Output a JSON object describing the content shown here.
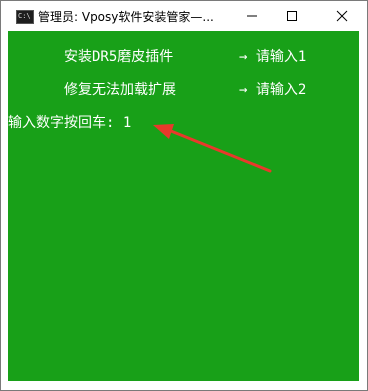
{
  "window": {
    "title": "管理员:  Vposy软件安装管家—...",
    "app_icon": "cmd-icon",
    "app_icon_text": "C:\\"
  },
  "controls": {
    "minimize": "minimize-icon",
    "maximize": "maximize-icon",
    "close": "close-icon"
  },
  "console": {
    "background": "#18a018",
    "text_color": "#ffffff",
    "menu": [
      {
        "label": "安装DR5磨皮插件",
        "hint": "→ 请输入1"
      },
      {
        "label": "修复无法加载扩展",
        "hint": "→ 请输入2"
      }
    ],
    "prompt": "输入数字按回车: 1"
  },
  "annotation": {
    "color": "#e8392b",
    "icon": "red-arrow-annotation"
  }
}
